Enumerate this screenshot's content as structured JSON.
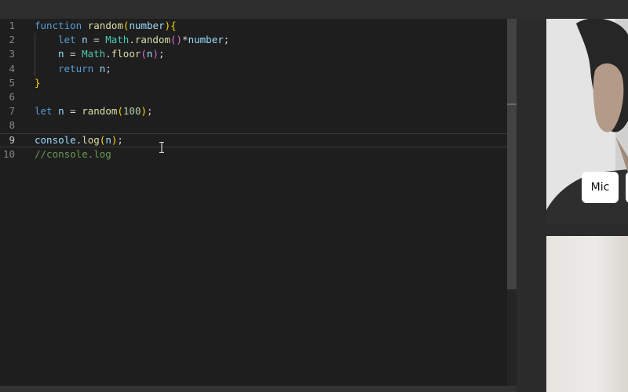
{
  "editor": {
    "current_line": 9,
    "lines": [
      {
        "number": "1",
        "tokens": [
          {
            "t": "function",
            "c": "kw"
          },
          {
            "t": " "
          },
          {
            "t": "random",
            "c": "fn"
          },
          {
            "t": "(",
            "c": "br1"
          },
          {
            "t": "number",
            "c": "var"
          },
          {
            "t": "){",
            "c": "br1"
          }
        ]
      },
      {
        "number": "2",
        "indent": 1,
        "tokens": [
          {
            "t": "let",
            "c": "kw"
          },
          {
            "t": " "
          },
          {
            "t": "n",
            "c": "var"
          },
          {
            "t": " = "
          },
          {
            "t": "Math",
            "c": "cls"
          },
          {
            "t": "."
          },
          {
            "t": "random",
            "c": "fn"
          },
          {
            "t": "()",
            "c": "br2"
          },
          {
            "t": "*"
          },
          {
            "t": "number",
            "c": "var"
          },
          {
            "t": ";"
          }
        ]
      },
      {
        "number": "3",
        "indent": 1,
        "tokens": [
          {
            "t": "n",
            "c": "var"
          },
          {
            "t": " = "
          },
          {
            "t": "Math",
            "c": "cls"
          },
          {
            "t": "."
          },
          {
            "t": "floor",
            "c": "fn"
          },
          {
            "t": "(",
            "c": "br2"
          },
          {
            "t": "n",
            "c": "var"
          },
          {
            "t": ")",
            "c": "br2"
          },
          {
            "t": ";"
          }
        ]
      },
      {
        "number": "4",
        "indent": 1,
        "tokens": [
          {
            "t": "return",
            "c": "kw"
          },
          {
            "t": " "
          },
          {
            "t": "n",
            "c": "var"
          },
          {
            "t": ";"
          }
        ]
      },
      {
        "number": "5",
        "tokens": [
          {
            "t": "}",
            "c": "br1"
          }
        ]
      },
      {
        "number": "6",
        "tokens": []
      },
      {
        "number": "7",
        "tokens": [
          {
            "t": "let",
            "c": "kw"
          },
          {
            "t": " "
          },
          {
            "t": "n",
            "c": "var"
          },
          {
            "t": " = "
          },
          {
            "t": "random",
            "c": "fn"
          },
          {
            "t": "(",
            "c": "br1"
          },
          {
            "t": "100",
            "c": "num"
          },
          {
            "t": ")",
            "c": "br1"
          },
          {
            "t": ";"
          }
        ]
      },
      {
        "number": "8",
        "tokens": []
      },
      {
        "number": "9",
        "tokens": [
          {
            "t": "console",
            "c": "var"
          },
          {
            "t": "."
          },
          {
            "t": "log",
            "c": "fn"
          },
          {
            "t": "(",
            "c": "br1"
          },
          {
            "t": "n",
            "c": "var"
          },
          {
            "t": ")",
            "c": "br1"
          },
          {
            "t": ";"
          }
        ]
      },
      {
        "number": "10",
        "tokens": [
          {
            "t": "//console.log",
            "c": "cmt"
          }
        ]
      }
    ]
  },
  "video": {
    "mic_label": "Mic"
  },
  "icons": {
    "text_cursor": "i-beam-cursor-icon"
  },
  "colors": {
    "editor_background": "#1e1e1e",
    "keyword": "#569cd6",
    "function": "#dcdcaa",
    "class": "#4ec9b0",
    "variable": "#9cdcfe",
    "number": "#b5cea8",
    "comment": "#6a9955",
    "bracket_level_1": "#ffd700",
    "bracket_level_2": "#da70d6"
  }
}
